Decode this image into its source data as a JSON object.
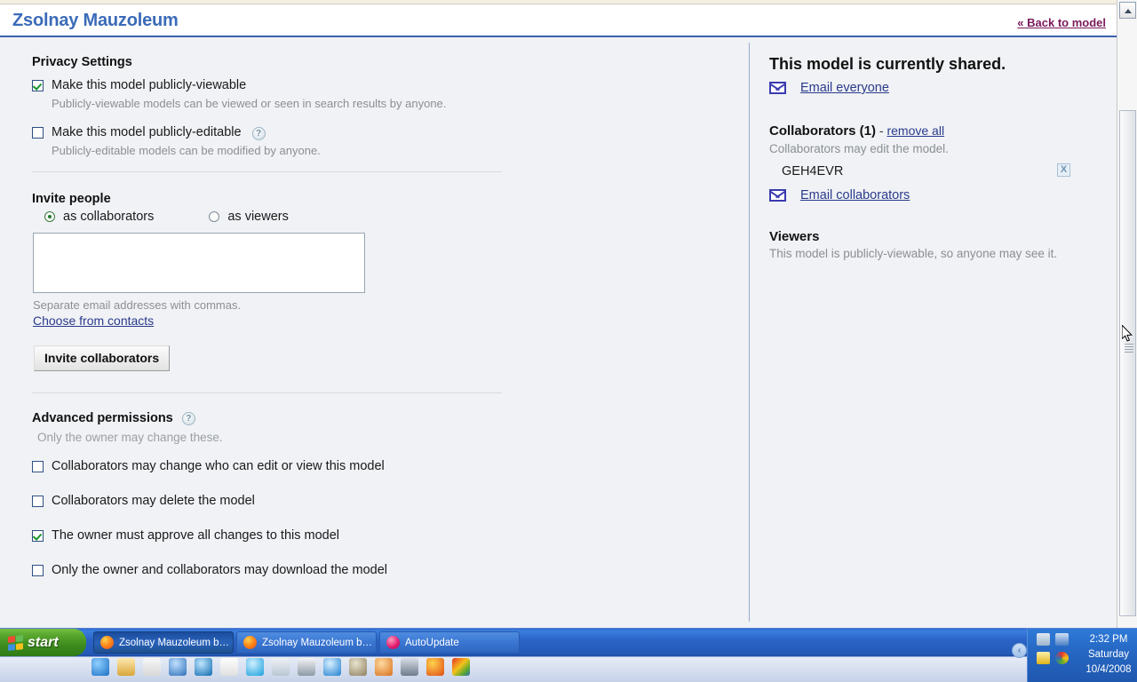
{
  "header": {
    "title": "Zsolnay Mauzoleum",
    "back_link": "« Back to model"
  },
  "privacy": {
    "section_title": "Privacy Settings",
    "items": [
      {
        "label": "Make this model publicly-viewable",
        "sublabel": "Publicly-viewable models can be viewed or seen in search results by anyone.",
        "checked": "true",
        "help": ""
      },
      {
        "label": "Make this model publicly-editable",
        "sublabel": "Publicly-editable models can be modified by anyone.",
        "checked": "false",
        "help": "?"
      }
    ]
  },
  "invite": {
    "section_title": "Invite people",
    "radio_collaborators": "as collaborators",
    "radio_viewers": "as viewers",
    "selected": "as collaborators",
    "textarea_value": "",
    "textarea_placeholder": "",
    "hint": "Separate email addresses with commas.",
    "contacts_link": "Choose from contacts",
    "submit_label": "Invite collaborators"
  },
  "advanced": {
    "section_title": "Advanced permissions",
    "help": "?",
    "note": "Only the owner may change these.",
    "items": [
      {
        "label": "Collaborators may change who can edit or view this model",
        "checked": "false"
      },
      {
        "label": "Collaborators may delete the model",
        "checked": "false"
      },
      {
        "label": "The owner must approve all changes to this model",
        "checked": "true"
      },
      {
        "label": "Only the owner and collaborators may download the model",
        "checked": "false"
      }
    ]
  },
  "sharing": {
    "status_title": "This model is currently shared.",
    "email_everyone": "Email everyone",
    "collaborators_heading": "Collaborators (1)",
    "dash": " - ",
    "remove_all": "remove all",
    "collaborators_note": "Collaborators may edit the model.",
    "collaborator_name": "GEH4EVR",
    "remove_icon": "X",
    "email_collaborators": "Email collaborators",
    "viewers_heading": "Viewers",
    "viewers_note": "This model is publicly-viewable, so anyone may see it."
  },
  "taskbar": {
    "start_label": "start",
    "tasks": [
      {
        "label": "Zsolnay Mauzoleum b…",
        "active": "true"
      },
      {
        "label": "Zsolnay Mauzoleum b…",
        "active": "false"
      },
      {
        "label": "AutoUpdate",
        "active": "false"
      }
    ],
    "tray_handle": "‹",
    "clock_time": "2:32 PM",
    "clock_day": "Saturday",
    "clock_date": "10/4/2008"
  },
  "colors": {
    "title_blue": "#3b6bb8",
    "link_blue": "#2a3a8c",
    "back_link_purple": "#7a1a5a",
    "check_green": "#17922b",
    "page_bg": "#f0f2f5"
  }
}
